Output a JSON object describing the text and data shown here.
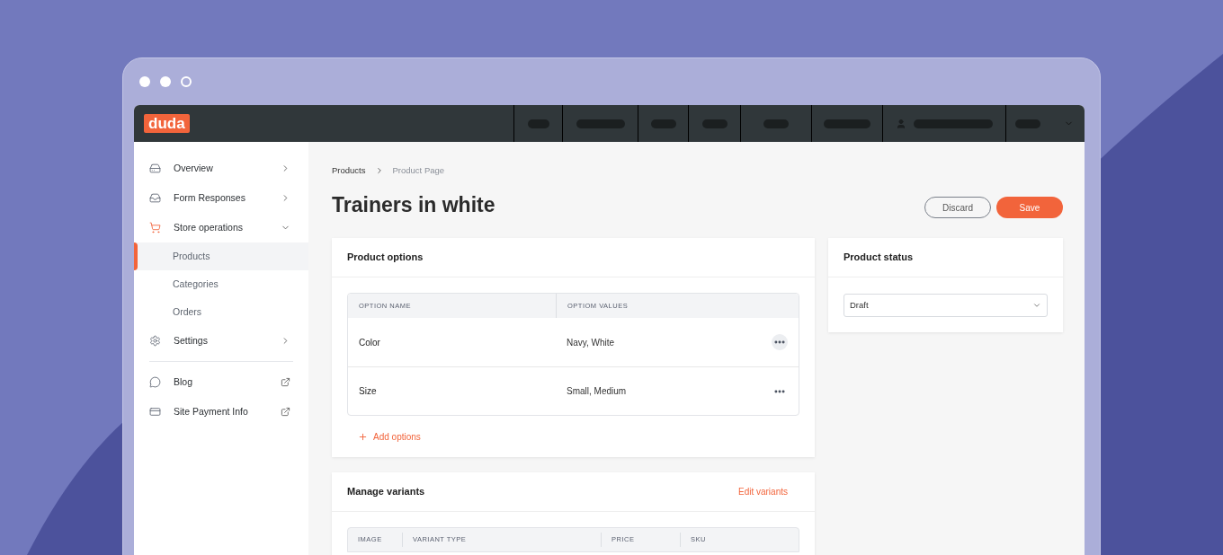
{
  "logo": "duda",
  "sidebar": {
    "sections": [
      {
        "items": [
          {
            "label": "Overview",
            "expanded": false,
            "selected": false
          },
          {
            "label": "Form Responses",
            "expanded": false,
            "selected": false
          },
          {
            "label": "Store operations",
            "expanded": true,
            "selected": false,
            "children": [
              {
                "label": "Products",
                "selected": true
              },
              {
                "label": "Categories",
                "selected": false
              },
              {
                "label": "Orders",
                "selected": false
              }
            ]
          },
          {
            "label": "Settings",
            "expanded": false,
            "selected": false
          }
        ]
      },
      {
        "items": [
          {
            "label": "Blog",
            "external": true,
            "selected": false
          },
          {
            "label": "Site Payment Info",
            "external": true,
            "selected": false
          }
        ]
      }
    ]
  },
  "breadcrumb": [
    {
      "label": "Products",
      "current": false
    },
    {
      "label": "Product Page",
      "current": true
    }
  ],
  "title": "Trainers in white",
  "buttons": [
    {
      "label": "Discard",
      "kind": "secondary"
    },
    {
      "label": "Save",
      "kind": "primary"
    }
  ],
  "product_options": {
    "title": "Product options",
    "columns": [
      "OPTION NAME",
      "OPTIOM VALUES"
    ],
    "rows": [
      {
        "name": "Color",
        "values": "Navy, White",
        "highlighted": true
      },
      {
        "name": "Size",
        "values": "Small, Medium",
        "highlighted": false
      }
    ],
    "add_label": "Add options"
  },
  "manage_variants": {
    "title": "Manage variants",
    "action": "Edit variants",
    "columns": [
      "IMAGE",
      "VARIANT TYPE",
      "PRICE",
      "SKU"
    ]
  },
  "product_status": {
    "title": "Product status",
    "select": {
      "value": "Draft"
    }
  }
}
